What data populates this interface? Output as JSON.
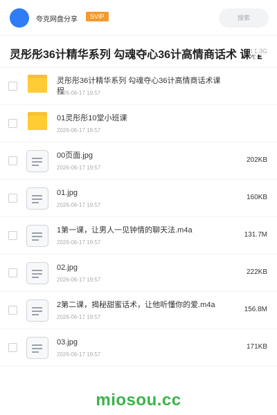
{
  "header": {
    "username": "夸克网盘分享",
    "badge": "SVIP",
    "search_label": "搜索"
  },
  "title": {
    "text": "灵彤彤36计精华系列 勾魂夺心36计高情商话术 课程",
    "size_text": "1.3G"
  },
  "files": [
    {
      "type": "folder",
      "name": "灵彤彤36计精华系列 勾魂夺心36计高情商话术课程",
      "date": "2026-06-17 19:57",
      "size": ""
    },
    {
      "type": "folder",
      "name": "01灵彤彤10堂小班课",
      "date": "2026-06-17 19:57",
      "size": ""
    },
    {
      "type": "file",
      "name": "00页面.jpg",
      "date": "2026-06-17 19:57",
      "size": "202KB"
    },
    {
      "type": "file",
      "name": "01.jpg",
      "date": "2026-06-17 19:57",
      "size": "160KB"
    },
    {
      "type": "file",
      "name": "1第一课，让男人一见钟情的聊天法.m4a",
      "date": "2026-06-17 19:57",
      "size": "131.7M"
    },
    {
      "type": "file",
      "name": "02.jpg",
      "date": "2026-06-17 19:57",
      "size": "222KB"
    },
    {
      "type": "file",
      "name": "2第二课，揭秘甜蜜话术，让他听懂你的爱.m4a",
      "date": "2026-06-17 19:57",
      "size": "156.8M"
    },
    {
      "type": "file",
      "name": "03.jpg",
      "date": "2026-06-17 19:57",
      "size": "171KB"
    }
  ],
  "watermark": "miosou.cc",
  "colors": {
    "avatar": "#2f7cf6",
    "badge": "#f29b2e",
    "folder": "#ffcc33",
    "watermark": "#3cb24a"
  },
  "icons": {
    "folder": "folder-icon",
    "file": "document-icon"
  }
}
